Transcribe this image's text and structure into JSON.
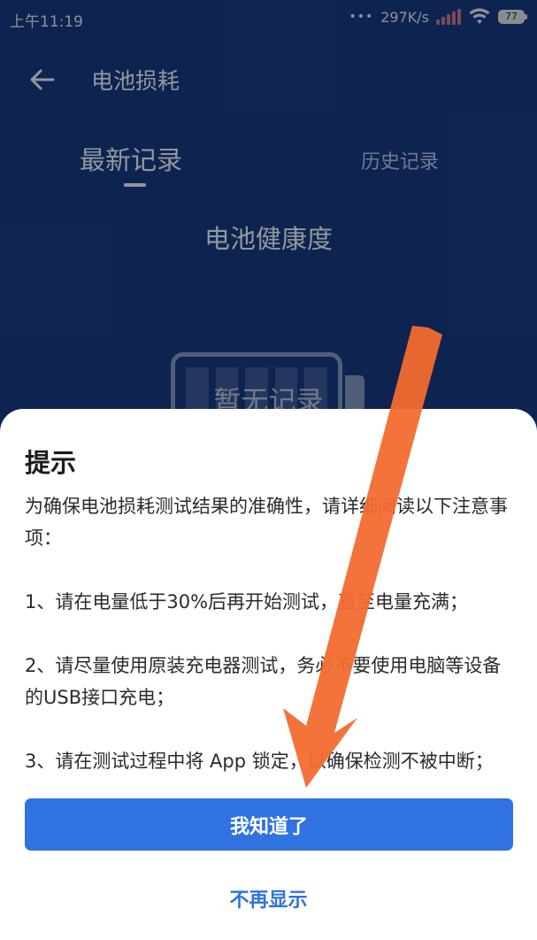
{
  "status_bar": {
    "time": "上午11:19",
    "network_speed": "297K/s",
    "battery_level": "77"
  },
  "header": {
    "title": "电池损耗"
  },
  "tabs": [
    {
      "label": "最新记录",
      "active": true
    },
    {
      "label": "历史记录",
      "active": false
    }
  ],
  "main": {
    "section_title": "电池健康度",
    "empty_text": "暂无记录"
  },
  "dialog": {
    "title": "提示",
    "intro": "为确保电池损耗测试结果的准确性，请详细阅读以下注意事项：",
    "item1": "1、请在电量低于30%后再开始测试，直至电量充满；",
    "item2": "2、请尽量使用原装充电器测试，务必不要使用电脑等设备的USB接口充电；",
    "item3": "3、请在测试过程中将 App 锁定，以确保检测不被中断；",
    "confirm_label": "我知道了",
    "dismiss_label": "不再显示"
  },
  "colors": {
    "background": "#163a83",
    "accent": "#2f72e0",
    "annotation_arrow": "#f36b2f"
  },
  "icons": {
    "back": "arrow-left-icon",
    "wifi": "wifi-icon",
    "signal": "signal-icon",
    "battery": "battery-icon"
  }
}
